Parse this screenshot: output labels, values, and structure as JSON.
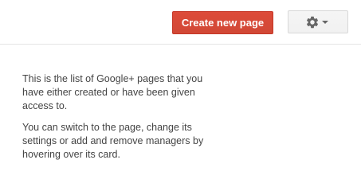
{
  "toolbar": {
    "create_label": "Create new page",
    "settings_icon": "gear-icon",
    "dropdown_icon": "chevron-down-icon"
  },
  "main": {
    "paragraph_1": "This is the list of Google+ pages that you have either created or have been given access to.",
    "paragraph_2": "You can switch to the page, change its settings or add and remove managers by hovering over its card."
  },
  "colors": {
    "primary_button": "#d14836",
    "text": "#444444",
    "divider": "#e5e5e5"
  }
}
